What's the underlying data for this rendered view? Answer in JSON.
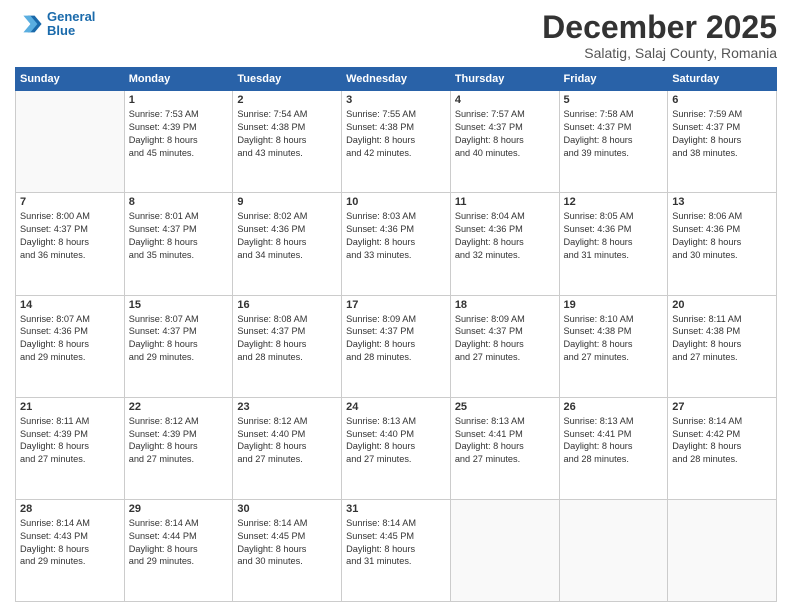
{
  "header": {
    "logo_line1": "General",
    "logo_line2": "Blue",
    "main_title": "December 2025",
    "subtitle": "Salatig, Salaj County, Romania"
  },
  "weekdays": [
    "Sunday",
    "Monday",
    "Tuesday",
    "Wednesday",
    "Thursday",
    "Friday",
    "Saturday"
  ],
  "weeks": [
    [
      {
        "day": "",
        "info": ""
      },
      {
        "day": "1",
        "info": "Sunrise: 7:53 AM\nSunset: 4:39 PM\nDaylight: 8 hours\nand 45 minutes."
      },
      {
        "day": "2",
        "info": "Sunrise: 7:54 AM\nSunset: 4:38 PM\nDaylight: 8 hours\nand 43 minutes."
      },
      {
        "day": "3",
        "info": "Sunrise: 7:55 AM\nSunset: 4:38 PM\nDaylight: 8 hours\nand 42 minutes."
      },
      {
        "day": "4",
        "info": "Sunrise: 7:57 AM\nSunset: 4:37 PM\nDaylight: 8 hours\nand 40 minutes."
      },
      {
        "day": "5",
        "info": "Sunrise: 7:58 AM\nSunset: 4:37 PM\nDaylight: 8 hours\nand 39 minutes."
      },
      {
        "day": "6",
        "info": "Sunrise: 7:59 AM\nSunset: 4:37 PM\nDaylight: 8 hours\nand 38 minutes."
      }
    ],
    [
      {
        "day": "7",
        "info": "Sunrise: 8:00 AM\nSunset: 4:37 PM\nDaylight: 8 hours\nand 36 minutes."
      },
      {
        "day": "8",
        "info": "Sunrise: 8:01 AM\nSunset: 4:37 PM\nDaylight: 8 hours\nand 35 minutes."
      },
      {
        "day": "9",
        "info": "Sunrise: 8:02 AM\nSunset: 4:36 PM\nDaylight: 8 hours\nand 34 minutes."
      },
      {
        "day": "10",
        "info": "Sunrise: 8:03 AM\nSunset: 4:36 PM\nDaylight: 8 hours\nand 33 minutes."
      },
      {
        "day": "11",
        "info": "Sunrise: 8:04 AM\nSunset: 4:36 PM\nDaylight: 8 hours\nand 32 minutes."
      },
      {
        "day": "12",
        "info": "Sunrise: 8:05 AM\nSunset: 4:36 PM\nDaylight: 8 hours\nand 31 minutes."
      },
      {
        "day": "13",
        "info": "Sunrise: 8:06 AM\nSunset: 4:36 PM\nDaylight: 8 hours\nand 30 minutes."
      }
    ],
    [
      {
        "day": "14",
        "info": "Sunrise: 8:07 AM\nSunset: 4:36 PM\nDaylight: 8 hours\nand 29 minutes."
      },
      {
        "day": "15",
        "info": "Sunrise: 8:07 AM\nSunset: 4:37 PM\nDaylight: 8 hours\nand 29 minutes."
      },
      {
        "day": "16",
        "info": "Sunrise: 8:08 AM\nSunset: 4:37 PM\nDaylight: 8 hours\nand 28 minutes."
      },
      {
        "day": "17",
        "info": "Sunrise: 8:09 AM\nSunset: 4:37 PM\nDaylight: 8 hours\nand 28 minutes."
      },
      {
        "day": "18",
        "info": "Sunrise: 8:09 AM\nSunset: 4:37 PM\nDaylight: 8 hours\nand 27 minutes."
      },
      {
        "day": "19",
        "info": "Sunrise: 8:10 AM\nSunset: 4:38 PM\nDaylight: 8 hours\nand 27 minutes."
      },
      {
        "day": "20",
        "info": "Sunrise: 8:11 AM\nSunset: 4:38 PM\nDaylight: 8 hours\nand 27 minutes."
      }
    ],
    [
      {
        "day": "21",
        "info": "Sunrise: 8:11 AM\nSunset: 4:39 PM\nDaylight: 8 hours\nand 27 minutes."
      },
      {
        "day": "22",
        "info": "Sunrise: 8:12 AM\nSunset: 4:39 PM\nDaylight: 8 hours\nand 27 minutes."
      },
      {
        "day": "23",
        "info": "Sunrise: 8:12 AM\nSunset: 4:40 PM\nDaylight: 8 hours\nand 27 minutes."
      },
      {
        "day": "24",
        "info": "Sunrise: 8:13 AM\nSunset: 4:40 PM\nDaylight: 8 hours\nand 27 minutes."
      },
      {
        "day": "25",
        "info": "Sunrise: 8:13 AM\nSunset: 4:41 PM\nDaylight: 8 hours\nand 27 minutes."
      },
      {
        "day": "26",
        "info": "Sunrise: 8:13 AM\nSunset: 4:41 PM\nDaylight: 8 hours\nand 28 minutes."
      },
      {
        "day": "27",
        "info": "Sunrise: 8:14 AM\nSunset: 4:42 PM\nDaylight: 8 hours\nand 28 minutes."
      }
    ],
    [
      {
        "day": "28",
        "info": "Sunrise: 8:14 AM\nSunset: 4:43 PM\nDaylight: 8 hours\nand 29 minutes."
      },
      {
        "day": "29",
        "info": "Sunrise: 8:14 AM\nSunset: 4:44 PM\nDaylight: 8 hours\nand 29 minutes."
      },
      {
        "day": "30",
        "info": "Sunrise: 8:14 AM\nSunset: 4:45 PM\nDaylight: 8 hours\nand 30 minutes."
      },
      {
        "day": "31",
        "info": "Sunrise: 8:14 AM\nSunset: 4:45 PM\nDaylight: 8 hours\nand 31 minutes."
      },
      {
        "day": "",
        "info": ""
      },
      {
        "day": "",
        "info": ""
      },
      {
        "day": "",
        "info": ""
      }
    ]
  ]
}
